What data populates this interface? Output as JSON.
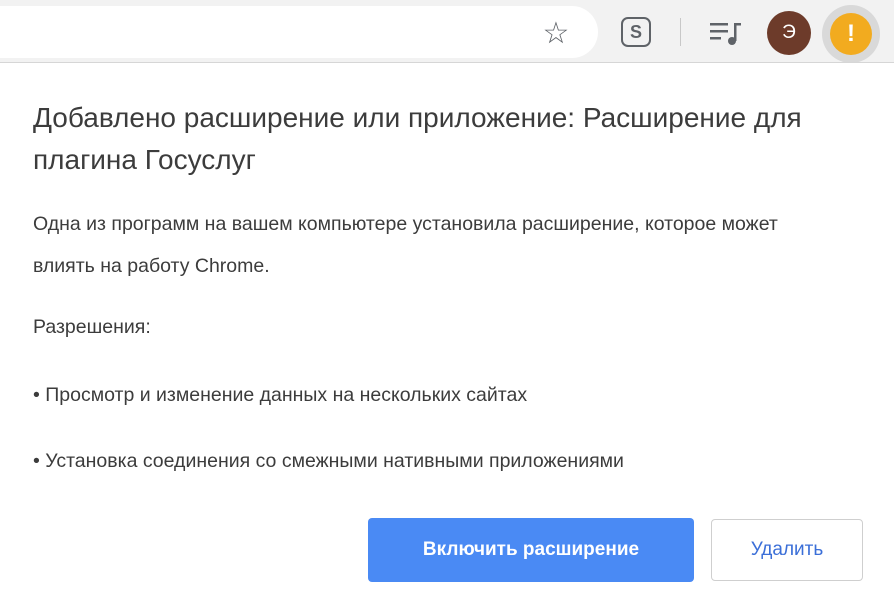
{
  "toolbar": {
    "icons": {
      "bookmark": "star-icon",
      "extension": "s-extension-icon",
      "media": "media-controls-icon",
      "alert": "alert-icon"
    },
    "star_glyph": "☆",
    "extension_letter": "S",
    "avatar_letter": "Э",
    "alert_glyph": "!",
    "colors": {
      "avatar_bg": "#6d3b2a",
      "alert_bg": "#f2ab1f"
    }
  },
  "dialog": {
    "title": "Добавлено расширение или приложение: Расширение для плагина Госуслуг",
    "description": "Одна из программ на вашем компьютере установила расширение, которое может влиять на работу Chrome.",
    "permissions_heading": "Разрешения:",
    "permissions": [
      "• Просмотр и изменение данных на нескольких сайтах",
      "• Установка соединения со смежными нативными приложениями"
    ],
    "enable_button": "Включить расширение",
    "remove_button": "Удалить",
    "colors": {
      "primary": "#4a8af4",
      "link": "#3b6fd8"
    }
  }
}
